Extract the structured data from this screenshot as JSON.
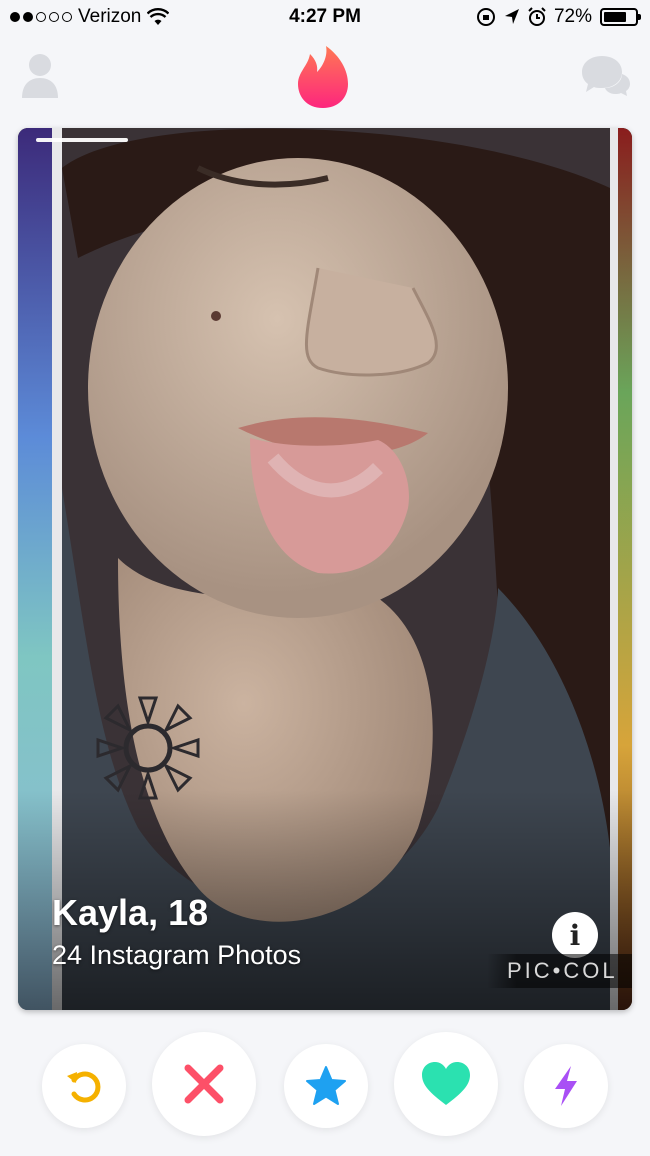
{
  "status_bar": {
    "carrier": "Verizon",
    "time": "4:27 PM",
    "battery": "72%",
    "battery_level": 0.72,
    "signal_bars_filled": 2,
    "signal_bars_total": 5
  },
  "nav": {
    "profile_icon": "person-icon",
    "center_icon": "flame-icon",
    "chat_icon": "chat-bubbles-icon",
    "accent": "#fe4e6f"
  },
  "card": {
    "name_age": "Kayla, 18",
    "subtitle": "24 Instagram Photos",
    "info_label": "i",
    "watermark": "PIC•COL"
  },
  "actions": [
    {
      "name": "rewind",
      "icon": "rewind-icon",
      "color": "#f5b100"
    },
    {
      "name": "nope",
      "icon": "x-icon",
      "color": "#fd5068"
    },
    {
      "name": "super-like",
      "icon": "star-icon",
      "color": "#1ea1f1"
    },
    {
      "name": "like",
      "icon": "heart-icon",
      "color": "#2be1b0"
    },
    {
      "name": "boost",
      "icon": "lightning-icon",
      "color": "#a94ff5"
    }
  ]
}
